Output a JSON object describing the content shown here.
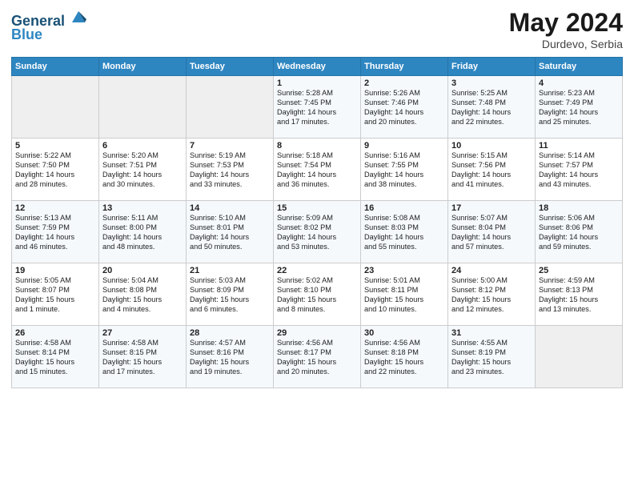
{
  "header": {
    "logo_line1": "General",
    "logo_line2": "Blue",
    "month": "May 2024",
    "location": "Durdevo, Serbia"
  },
  "weekdays": [
    "Sunday",
    "Monday",
    "Tuesday",
    "Wednesday",
    "Thursday",
    "Friday",
    "Saturday"
  ],
  "weeks": [
    [
      {
        "day": "",
        "info": ""
      },
      {
        "day": "",
        "info": ""
      },
      {
        "day": "",
        "info": ""
      },
      {
        "day": "1",
        "info": "Sunrise: 5:28 AM\nSunset: 7:45 PM\nDaylight: 14 hours\nand 17 minutes."
      },
      {
        "day": "2",
        "info": "Sunrise: 5:26 AM\nSunset: 7:46 PM\nDaylight: 14 hours\nand 20 minutes."
      },
      {
        "day": "3",
        "info": "Sunrise: 5:25 AM\nSunset: 7:48 PM\nDaylight: 14 hours\nand 22 minutes."
      },
      {
        "day": "4",
        "info": "Sunrise: 5:23 AM\nSunset: 7:49 PM\nDaylight: 14 hours\nand 25 minutes."
      }
    ],
    [
      {
        "day": "5",
        "info": "Sunrise: 5:22 AM\nSunset: 7:50 PM\nDaylight: 14 hours\nand 28 minutes."
      },
      {
        "day": "6",
        "info": "Sunrise: 5:20 AM\nSunset: 7:51 PM\nDaylight: 14 hours\nand 30 minutes."
      },
      {
        "day": "7",
        "info": "Sunrise: 5:19 AM\nSunset: 7:53 PM\nDaylight: 14 hours\nand 33 minutes."
      },
      {
        "day": "8",
        "info": "Sunrise: 5:18 AM\nSunset: 7:54 PM\nDaylight: 14 hours\nand 36 minutes."
      },
      {
        "day": "9",
        "info": "Sunrise: 5:16 AM\nSunset: 7:55 PM\nDaylight: 14 hours\nand 38 minutes."
      },
      {
        "day": "10",
        "info": "Sunrise: 5:15 AM\nSunset: 7:56 PM\nDaylight: 14 hours\nand 41 minutes."
      },
      {
        "day": "11",
        "info": "Sunrise: 5:14 AM\nSunset: 7:57 PM\nDaylight: 14 hours\nand 43 minutes."
      }
    ],
    [
      {
        "day": "12",
        "info": "Sunrise: 5:13 AM\nSunset: 7:59 PM\nDaylight: 14 hours\nand 46 minutes."
      },
      {
        "day": "13",
        "info": "Sunrise: 5:11 AM\nSunset: 8:00 PM\nDaylight: 14 hours\nand 48 minutes."
      },
      {
        "day": "14",
        "info": "Sunrise: 5:10 AM\nSunset: 8:01 PM\nDaylight: 14 hours\nand 50 minutes."
      },
      {
        "day": "15",
        "info": "Sunrise: 5:09 AM\nSunset: 8:02 PM\nDaylight: 14 hours\nand 53 minutes."
      },
      {
        "day": "16",
        "info": "Sunrise: 5:08 AM\nSunset: 8:03 PM\nDaylight: 14 hours\nand 55 minutes."
      },
      {
        "day": "17",
        "info": "Sunrise: 5:07 AM\nSunset: 8:04 PM\nDaylight: 14 hours\nand 57 minutes."
      },
      {
        "day": "18",
        "info": "Sunrise: 5:06 AM\nSunset: 8:06 PM\nDaylight: 14 hours\nand 59 minutes."
      }
    ],
    [
      {
        "day": "19",
        "info": "Sunrise: 5:05 AM\nSunset: 8:07 PM\nDaylight: 15 hours\nand 1 minute."
      },
      {
        "day": "20",
        "info": "Sunrise: 5:04 AM\nSunset: 8:08 PM\nDaylight: 15 hours\nand 4 minutes."
      },
      {
        "day": "21",
        "info": "Sunrise: 5:03 AM\nSunset: 8:09 PM\nDaylight: 15 hours\nand 6 minutes."
      },
      {
        "day": "22",
        "info": "Sunrise: 5:02 AM\nSunset: 8:10 PM\nDaylight: 15 hours\nand 8 minutes."
      },
      {
        "day": "23",
        "info": "Sunrise: 5:01 AM\nSunset: 8:11 PM\nDaylight: 15 hours\nand 10 minutes."
      },
      {
        "day": "24",
        "info": "Sunrise: 5:00 AM\nSunset: 8:12 PM\nDaylight: 15 hours\nand 12 minutes."
      },
      {
        "day": "25",
        "info": "Sunrise: 4:59 AM\nSunset: 8:13 PM\nDaylight: 15 hours\nand 13 minutes."
      }
    ],
    [
      {
        "day": "26",
        "info": "Sunrise: 4:58 AM\nSunset: 8:14 PM\nDaylight: 15 hours\nand 15 minutes."
      },
      {
        "day": "27",
        "info": "Sunrise: 4:58 AM\nSunset: 8:15 PM\nDaylight: 15 hours\nand 17 minutes."
      },
      {
        "day": "28",
        "info": "Sunrise: 4:57 AM\nSunset: 8:16 PM\nDaylight: 15 hours\nand 19 minutes."
      },
      {
        "day": "29",
        "info": "Sunrise: 4:56 AM\nSunset: 8:17 PM\nDaylight: 15 hours\nand 20 minutes."
      },
      {
        "day": "30",
        "info": "Sunrise: 4:56 AM\nSunset: 8:18 PM\nDaylight: 15 hours\nand 22 minutes."
      },
      {
        "day": "31",
        "info": "Sunrise: 4:55 AM\nSunset: 8:19 PM\nDaylight: 15 hours\nand 23 minutes."
      },
      {
        "day": "",
        "info": ""
      }
    ]
  ]
}
